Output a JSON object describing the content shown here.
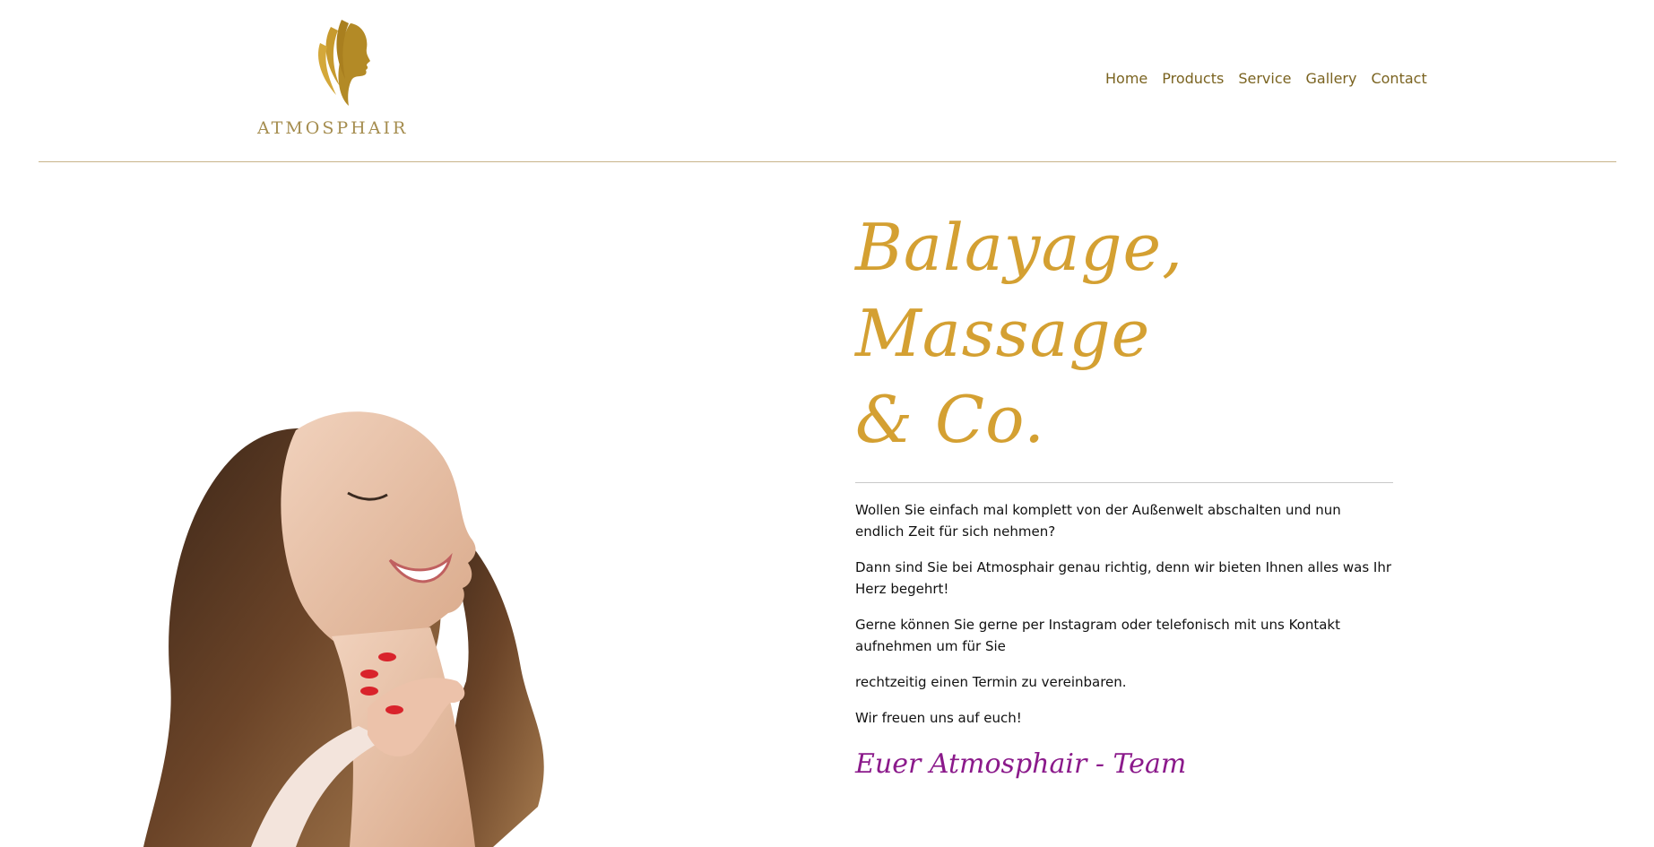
{
  "header": {
    "logo_text": "ATMOSPHAIR",
    "nav": [
      {
        "label": "Home"
      },
      {
        "label": "Products"
      },
      {
        "label": "Service"
      },
      {
        "label": "Gallery"
      },
      {
        "label": "Contact"
      }
    ]
  },
  "hero": {
    "headline_line1": "Balayage, Massage",
    "headline_line2": "& Co.",
    "paragraphs": [
      "Wollen Sie einfach mal komplett von der Außenwelt abschalten und nun endlich Zeit für sich nehmen?",
      "Dann sind Sie bei Atmosphair genau richtig, denn wir bieten Ihnen alles was Ihr Herz begehrt!",
      "Gerne können Sie gerne per Instagram oder telefonisch mit uns Kontakt aufnehmen um für Sie",
      "rechtzeitig einen Termin zu vereinbaren.",
      "Wir freuen uns auf euch!"
    ],
    "signature": "Euer Atmosphair - Team"
  },
  "colors": {
    "gold": "#d4a032",
    "nav_brown": "#7a6320",
    "logo_gold": "#a58d4f",
    "signature_purple": "#8b1a8b",
    "divider": "#c8b48a"
  },
  "icons": {
    "logo": "woman-profile-hair-logo-icon",
    "hero": "smiling-woman-photo"
  }
}
